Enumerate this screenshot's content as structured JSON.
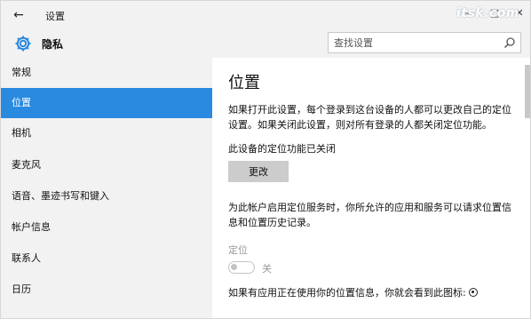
{
  "titlebar": {
    "back_glyph": "←",
    "title": "设置",
    "minimize_glyph": "—",
    "maximize_glyph": "□",
    "close_glyph": "✕",
    "watermark": "itsk.com"
  },
  "header": {
    "section_title": "隐私",
    "search_placeholder": "查找设置"
  },
  "sidebar": {
    "items": [
      {
        "label": "常规"
      },
      {
        "label": "位置"
      },
      {
        "label": "相机"
      },
      {
        "label": "麦克风"
      },
      {
        "label": "语音、墨迹书写和键入"
      },
      {
        "label": "帐户信息"
      },
      {
        "label": "联系人"
      },
      {
        "label": "日历"
      }
    ],
    "active_index": 1
  },
  "main": {
    "title": "位置",
    "description": "如果打开此设置，每个登录到这台设备的人都可以更改自己的定位设置。如果关闭此设置，则对所有登录的人都关闭定位功能。",
    "device_status": "此设备的定位功能已关闭",
    "change_button": "更改",
    "account_info": "为此帐户启用定位服务时，你所允许的应用和服务可以请求位置信息和位置历史记录。",
    "location_label": "定位",
    "toggle_state": "关",
    "icon_note": "如果有应用正在使用你的位置信息，你就会看到此图标:"
  },
  "colors": {
    "accent": "#2a8ae0",
    "sidebar_bg": "#f2f2f2",
    "button_bg": "#cccccc"
  }
}
